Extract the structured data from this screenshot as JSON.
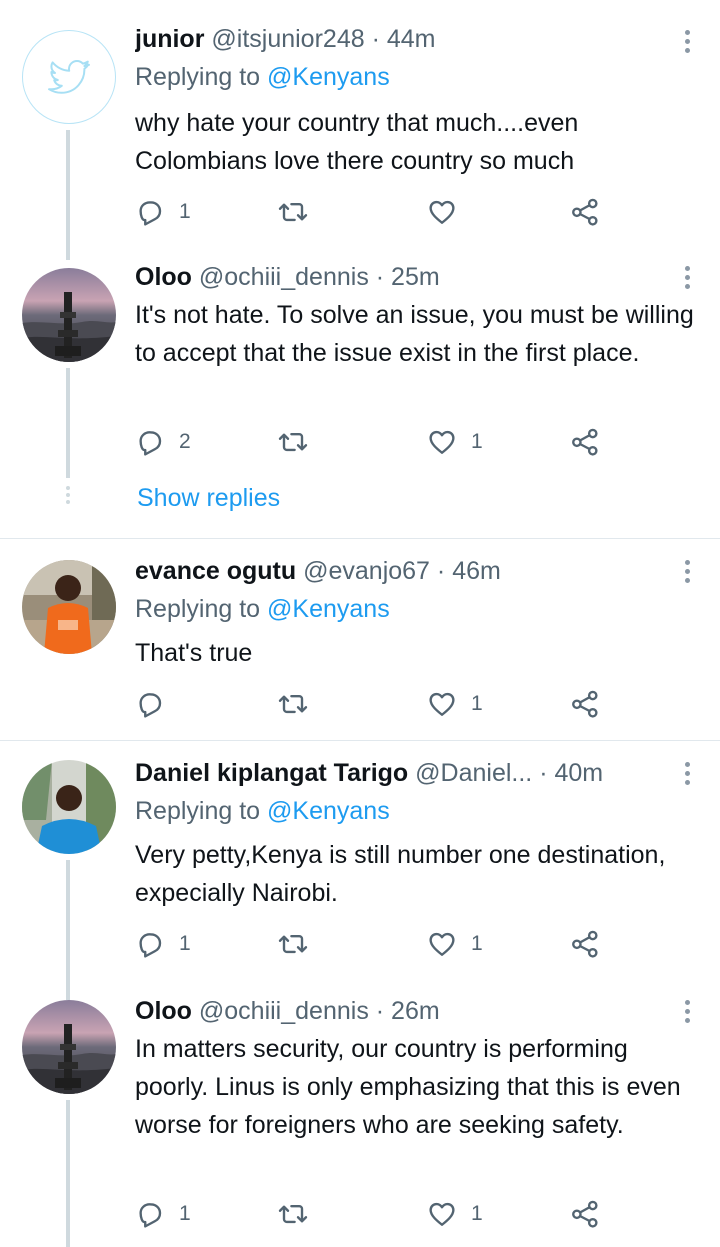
{
  "tweets": [
    {
      "name": "junior",
      "handle": "@itsjunior248",
      "dot": "·",
      "time": "44m",
      "replying_prefix": "Replying to",
      "replying_mention": "@Kenyans",
      "body": "why hate your country that much....even Colombians love there country so much",
      "reply_count": "1",
      "retweet_count": "",
      "like_count": "",
      "avatar": "twitter-default-avatar"
    },
    {
      "name": "Oloo",
      "handle": "@ochiii_dennis",
      "dot": "·",
      "time": "25m",
      "body": "It's not hate. To solve an issue, you must be willing to accept that the issue exist in the first place.",
      "reply_count": "2",
      "retweet_count": "",
      "like_count": "1",
      "avatar": "sunset-pier-photo"
    },
    {
      "name": "evance ogutu",
      "handle": "@evanjo67",
      "dot": "·",
      "time": "46m",
      "replying_prefix": "Replying to",
      "replying_mention": "@Kenyans",
      "body": "That's true",
      "reply_count": "",
      "retweet_count": "",
      "like_count": "1",
      "avatar": "child-orange-shirt-photo"
    },
    {
      "name": "Daniel kiplangat Tarigo",
      "handle": "@Daniel...",
      "dot": "·",
      "time": "40m",
      "replying_prefix": "Replying to",
      "replying_mention": "@Kenyans",
      "body": "Very petty,Kenya is still number one destination, expecially Nairobi.",
      "reply_count": "1",
      "retweet_count": "",
      "like_count": "1",
      "avatar": "man-blue-shirt-photo"
    },
    {
      "name": "Oloo",
      "handle": "@ochiii_dennis",
      "dot": "·",
      "time": "26m",
      "body": "In matters security, our country is performing poorly. Linus is only emphasizing that this is even worse for foreigners who are seeking safety.",
      "reply_count": "1",
      "retweet_count": "",
      "like_count": "1",
      "avatar": "sunset-pier-photo"
    }
  ],
  "show_replies_label": "Show replies",
  "colors": {
    "link": "#1d9bf0",
    "secondary_text": "#536471",
    "icon": "#536471",
    "thread_line": "#cfd9de"
  }
}
